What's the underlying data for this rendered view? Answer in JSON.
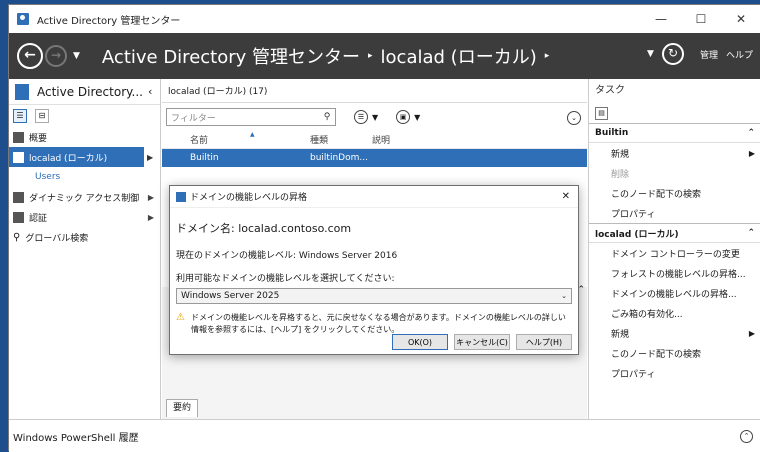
{
  "window": {
    "title": "Active Directory 管理センター",
    "minimize": "—",
    "maximize": "☐",
    "close": "✕"
  },
  "nav": {
    "breadcrumb": [
      "Active Directory 管理センター",
      "localad (ローカル)"
    ],
    "manage_label": "管理",
    "help_label": "ヘルプ"
  },
  "left": {
    "title": "Active Directory...",
    "items": [
      {
        "label": "概要"
      },
      {
        "label": "localad (ローカル)"
      },
      {
        "label": "Users"
      },
      {
        "label": "ダイナミック アクセス制御"
      },
      {
        "label": "認証"
      },
      {
        "label": "グローバル検索"
      }
    ]
  },
  "center": {
    "header": "localad (ローカル)  (17)",
    "filter_placeholder": "フィルター",
    "columns": [
      "名前",
      "種類",
      "説明"
    ],
    "rows": [
      {
        "name": "Builtin",
        "type": "builtinDom..."
      }
    ],
    "summary_tab": "要約"
  },
  "right": {
    "title": "タスク",
    "sections": [
      {
        "label": "Builtin",
        "items": [
          {
            "label": "新規",
            "sub": true
          },
          {
            "label": "削除",
            "disabled": true
          },
          {
            "label": "このノード配下の検索"
          },
          {
            "label": "プロパティ"
          }
        ]
      },
      {
        "label": "localad (ローカル)",
        "items": [
          {
            "label": "ドメイン コントローラーの変更"
          },
          {
            "label": "フォレストの機能レベルの昇格..."
          },
          {
            "label": "ドメインの機能レベルの昇格..."
          },
          {
            "label": "ごみ箱の有効化..."
          },
          {
            "label": "新規",
            "sub": true
          },
          {
            "label": "このノード配下の検索"
          },
          {
            "label": "プロパティ"
          }
        ]
      }
    ]
  },
  "powershell": {
    "label": "Windows PowerShell 履歴"
  },
  "dialog": {
    "title": "ドメインの機能レベルの昇格",
    "domain_line": "ドメイン名: localad.contoso.com",
    "current_line": "現在のドメインの機能レベル: Windows Server 2016",
    "select_label": "利用可能なドメインの機能レベルを選択してください:",
    "selected": "Windows Server 2025",
    "warning": "ドメインの機能レベルを昇格すると、元に戻せなくなる場合があります。ドメインの機能レベルの詳しい情報を参照するには、[ヘルプ] をクリックしてください。",
    "ok": "OK(O)",
    "cancel": "キャンセル(C)",
    "help": "ヘルプ(H)"
  },
  "colors": {
    "accent": "#2e6fb7",
    "navbar": "#3c3c3c",
    "desktop": "#1e4e8c"
  }
}
